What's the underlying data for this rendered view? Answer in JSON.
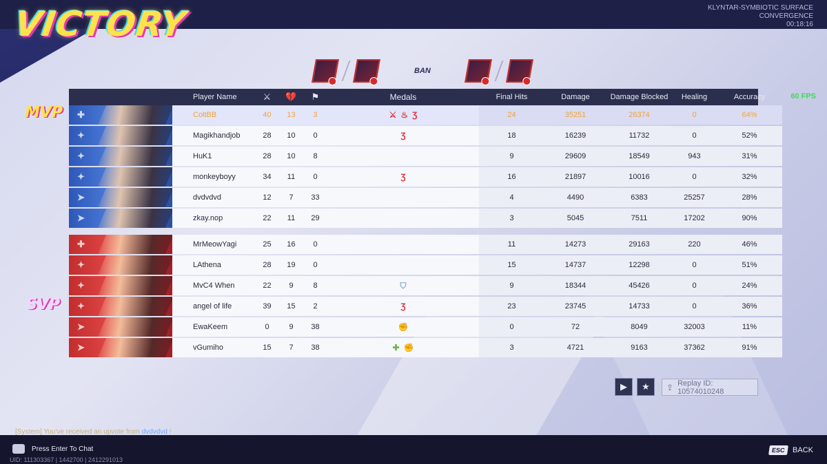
{
  "header": {
    "title": "VICTORY",
    "map_line1": "KLYNTAR-SYMBIOTIC SURFACE",
    "map_line2": "CONVERGENCE",
    "match_time": "00:18:16",
    "fps": "60 FPS"
  },
  "bans": {
    "label": "BAN"
  },
  "labels": {
    "mvp": "MVP",
    "svp": "SVP"
  },
  "columns": {
    "player": "Player Name",
    "kills_icon": "kills-icon",
    "deaths_icon": "deaths-icon",
    "assists_icon": "assists-icon",
    "medals": "Medals",
    "final_hits": "Final Hits",
    "damage": "Damage",
    "damage_blocked": "Damage Blocked",
    "healing": "Healing",
    "accuracy": "Accuracy"
  },
  "team_blue": [
    {
      "name": "ColtBB",
      "k": "40",
      "d": "13",
      "a": "3",
      "medals": "⚔ ♨ Ʒ",
      "final_hits": "24",
      "damage": "35251",
      "blocked": "26374",
      "healing": "0",
      "accuracy": "64%",
      "role": "vanguard-icon"
    },
    {
      "name": "Magikhandjob",
      "k": "28",
      "d": "10",
      "a": "0",
      "medals": "Ʒ",
      "final_hits": "18",
      "damage": "16239",
      "blocked": "11732",
      "healing": "0",
      "accuracy": "52%",
      "role": "duelist-icon"
    },
    {
      "name": "HuK1",
      "k": "28",
      "d": "10",
      "a": "8",
      "medals": "",
      "final_hits": "9",
      "damage": "29609",
      "blocked": "18549",
      "healing": "943",
      "accuracy": "31%",
      "role": "duelist-icon"
    },
    {
      "name": "monkeyboyy",
      "k": "34",
      "d": "11",
      "a": "0",
      "medals": "Ʒ",
      "final_hits": "16",
      "damage": "21897",
      "blocked": "10016",
      "healing": "0",
      "accuracy": "32%",
      "role": "duelist-icon"
    },
    {
      "name": "dvdvdvd",
      "k": "12",
      "d": "7",
      "a": "33",
      "medals": "",
      "final_hits": "4",
      "damage": "4490",
      "blocked": "6383",
      "healing": "25257",
      "accuracy": "28%",
      "role": "strategist-icon"
    },
    {
      "name": "zkay.nop",
      "k": "22",
      "d": "11",
      "a": "29",
      "medals": "",
      "final_hits": "3",
      "damage": "5045",
      "blocked": "7511",
      "healing": "17202",
      "accuracy": "90%",
      "role": "strategist-icon"
    }
  ],
  "team_red": [
    {
      "name": "MrMeowYagi",
      "k": "25",
      "d": "16",
      "a": "0",
      "medals": "",
      "final_hits": "11",
      "damage": "14273",
      "blocked": "29163",
      "healing": "220",
      "accuracy": "46%",
      "role": "vanguard-icon"
    },
    {
      "name": "LAthena",
      "k": "28",
      "d": "19",
      "a": "0",
      "medals": "",
      "final_hits": "15",
      "damage": "14737",
      "blocked": "12298",
      "healing": "0",
      "accuracy": "51%",
      "role": "duelist-icon"
    },
    {
      "name": "MvC4 When",
      "k": "22",
      "d": "9",
      "a": "8",
      "medals": "⛉",
      "final_hits": "9",
      "damage": "18344",
      "blocked": "45426",
      "healing": "0",
      "accuracy": "24%",
      "role": "duelist-icon"
    },
    {
      "name": "angel of life",
      "k": "39",
      "d": "15",
      "a": "2",
      "medals": "Ʒ",
      "final_hits": "23",
      "damage": "23745",
      "blocked": "14733",
      "healing": "0",
      "accuracy": "36%",
      "role": "duelist-icon"
    },
    {
      "name": "EwaKeem",
      "k": "0",
      "d": "9",
      "a": "38",
      "medals": "✊",
      "final_hits": "0",
      "damage": "72",
      "blocked": "8049",
      "healing": "32003",
      "accuracy": "11%",
      "role": "strategist-icon"
    },
    {
      "name": "vGumiho",
      "k": "15",
      "d": "7",
      "a": "38",
      "medals": "✚ ✊",
      "final_hits": "3",
      "damage": "4721",
      "blocked": "9163",
      "healing": "37362",
      "accuracy": "91%",
      "role": "strategist-icon"
    }
  ],
  "controls": {
    "play_icon": "play-icon",
    "favorite_icon": "star-icon",
    "replay_label": "Replay ID: 10574010248"
  },
  "footer": {
    "system_prefix": "[System] You've received an upvote from ",
    "system_player": "dvdvdvd",
    "system_suffix": " !",
    "chat_hint": "Press Enter To Chat",
    "uid": "UID: 111303367 | 1442700 | 2412291013",
    "esc_key": "ESC",
    "back_label": "BACK"
  }
}
